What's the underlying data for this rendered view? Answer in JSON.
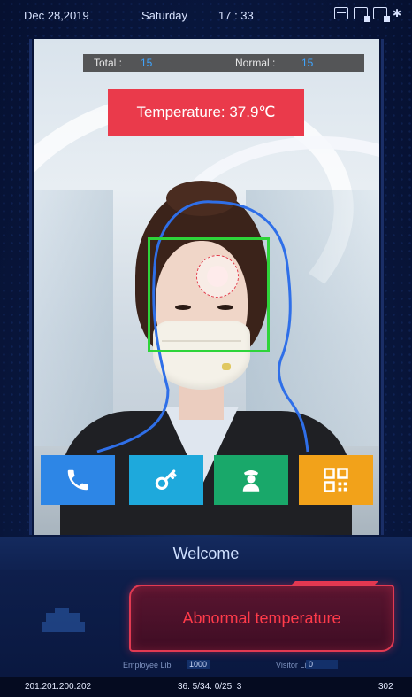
{
  "status": {
    "date": "Dec 28,2019",
    "day": "Saturday",
    "time": "17 : 33",
    "icons": [
      "face-recognition-icon",
      "id-card-icon",
      "document-icon",
      "document-icon",
      "bluetooth-icon"
    ]
  },
  "counter": {
    "total_label": "Total :",
    "total_value": "15",
    "normal_label": "Normal :",
    "normal_value": "15"
  },
  "temperature_banner": "Temperature: 37.9℃",
  "actions": [
    {
      "name": "call",
      "icon": "phone-icon",
      "color": "#2d86e6"
    },
    {
      "name": "unlock",
      "icon": "key-icon",
      "color": "#1ea9dc"
    },
    {
      "name": "security-guard",
      "icon": "guard-icon",
      "color": "#19a86a"
    },
    {
      "name": "qr-code",
      "icon": "qr-code-icon",
      "color": "#f2a21a"
    }
  ],
  "welcome": "Welcome",
  "alert": {
    "text": "Abnormal temperature",
    "color": "#ff3b4a"
  },
  "libraries": {
    "employee_label": "Employee Lib",
    "employee_value": "1000",
    "visitor_label": "Visitor Lib",
    "visitor_value": "0"
  },
  "footer": {
    "ip": "201.201.200.202",
    "coords": "36. 5/34. 0/25. 3",
    "number": "302"
  },
  "colors": {
    "face_box": "#2ed43a",
    "head_outline": "#2f6fe8",
    "temperature_banner_bg": "#ea3a4b",
    "counter_value": "#3fa5ff"
  }
}
